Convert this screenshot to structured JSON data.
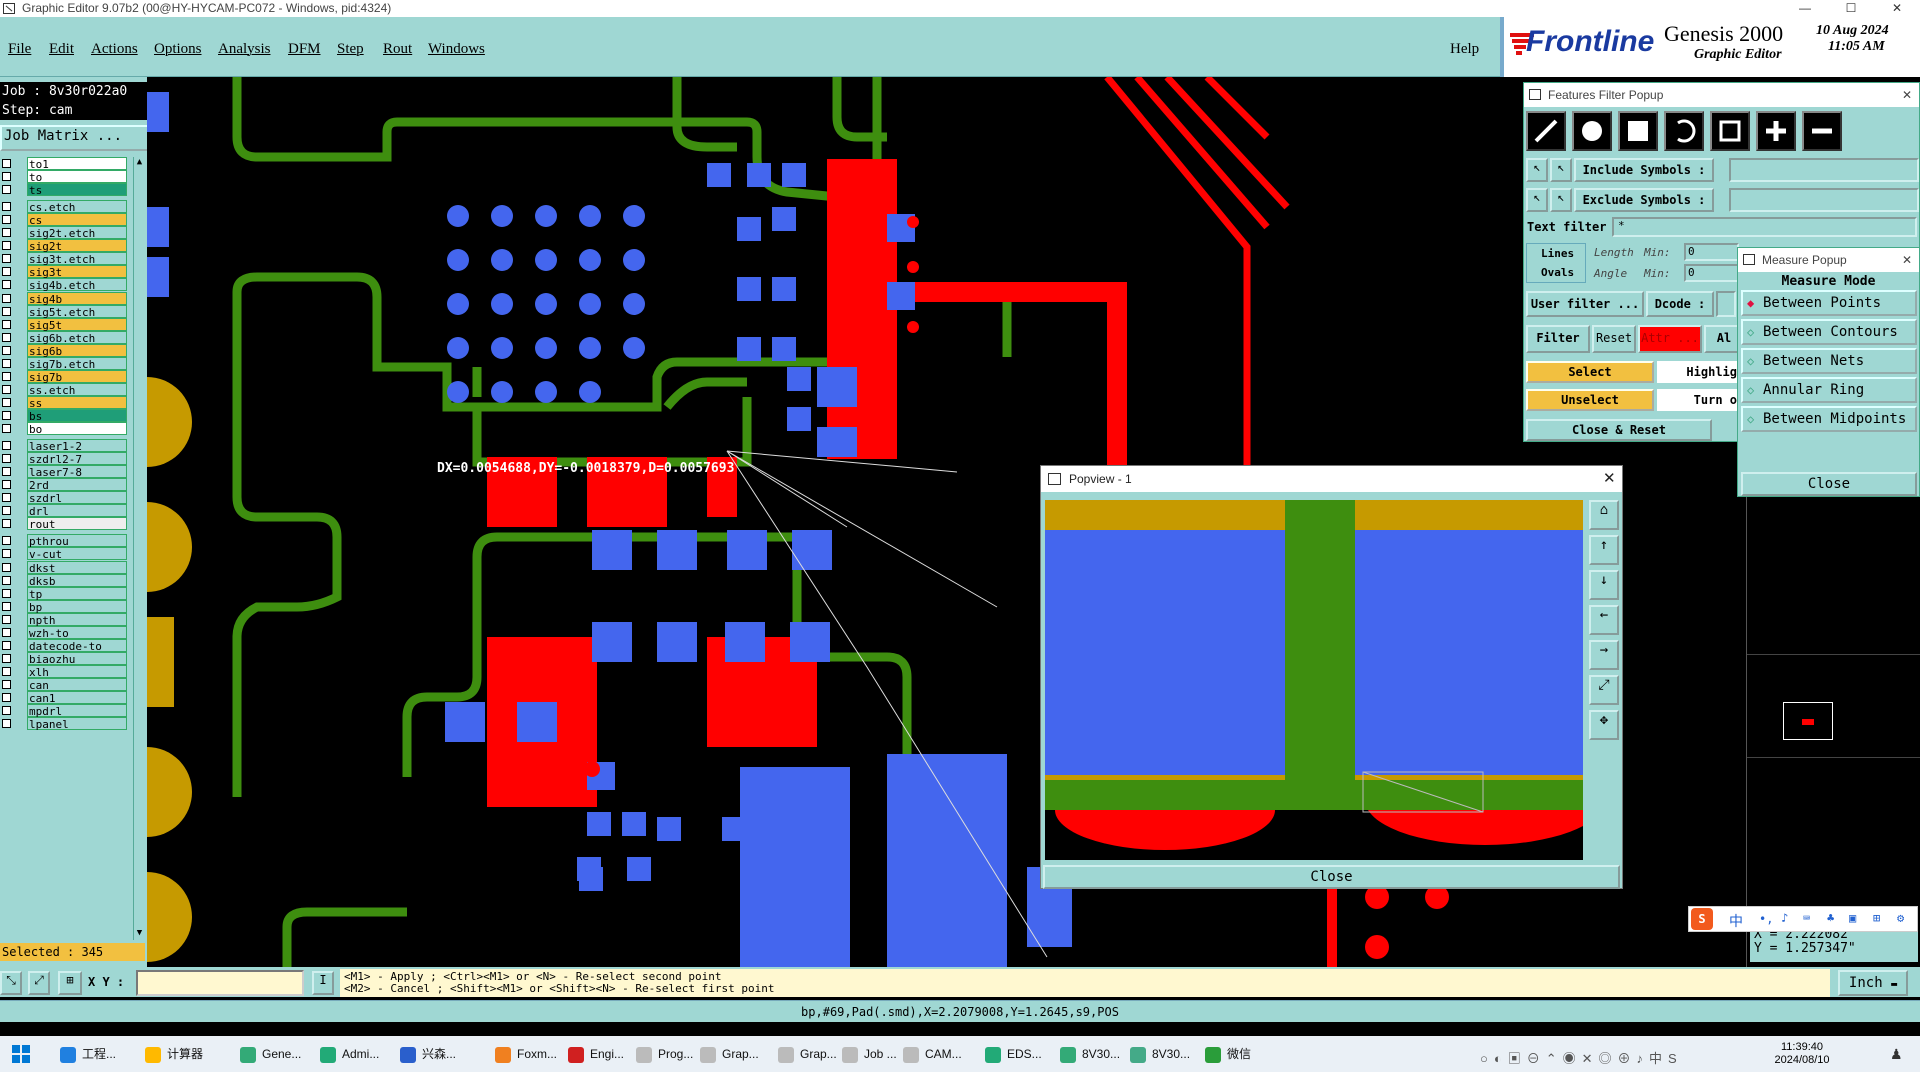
{
  "window": {
    "title": "Graphic Editor 9.07b2 (00@HY-HYCAM-PC072 - Windows, pid:4324)",
    "controls": [
      "—",
      "☐",
      "✕"
    ]
  },
  "menu": {
    "items": [
      "File",
      "Edit",
      "Actions",
      "Options",
      "Analysis",
      "DFM",
      "Step",
      "Rout",
      "Windows"
    ],
    "help": "Help"
  },
  "brand": {
    "logo": "Frontline",
    "product": "Genesis 2000",
    "subtitle": "Graphic Editor",
    "date": "10 Aug 2024",
    "time": "11:05 AM"
  },
  "left_panel": {
    "job": "Job : 8v30r022a0",
    "step": "Step: cam",
    "job_matrix": "Job Matrix ...",
    "layers": [
      "to1",
      "to",
      "ts",
      "cs.etch",
      "cs",
      "sig2t.etch",
      "sig2t",
      "sig3t.etch",
      "sig3t",
      "sig4b.etch",
      "sig4b",
      "sig5t.etch",
      "sig5t",
      "sig6b.etch",
      "sig6b",
      "sig7b.etch",
      "sig7b",
      "ss.etch",
      "ss",
      "bs",
      "bo",
      "laser1-2",
      "szdrl2-7",
      "laser7-8",
      "2rd",
      "szdrl",
      "drl",
      "rout",
      "pthrou",
      "v-cut",
      "dkst",
      "dksb",
      "tp",
      "bp",
      "npth",
      "wzh-to",
      "datecode-to",
      "biaozhu",
      "xlh",
      "can",
      "can1",
      "mpdrl",
      "lpanel"
    ],
    "selected": "Selected : 345"
  },
  "canvas": {
    "measure_readout": "DX=0.0054688,DY=-0.0018379,D=0.0057693"
  },
  "features_filter": {
    "title": "Features Filter Popup",
    "include_symbols": "Include Symbols :",
    "exclude_symbols": "Exclude Symbols :",
    "text_filter": "Text filter",
    "text_filter_value": "*",
    "lines": "Lines",
    "ovals": "Ovals",
    "length": "Length",
    "angle": "Angle",
    "min": "Min:",
    "min_value": "0",
    "user_filter": "User filter ...",
    "dcode": "Dcode :",
    "filter": "Filter",
    "reset": "Reset",
    "attr": "Attr ...",
    "all": "Al",
    "select": "Select",
    "unselect": "Unselect",
    "highlight": "Highlig",
    "turn_on": "Turn o",
    "close_reset": "Close & Reset"
  },
  "measure_popup": {
    "title": "Measure Popup",
    "mode_header": "Measure Mode",
    "options": [
      "Between Points",
      "Between Contours",
      "Between Nets",
      "Annular Ring",
      "Between Midpoints"
    ],
    "close": "Close"
  },
  "popview": {
    "title": "Popview - 1",
    "close": "Close"
  },
  "coords": {
    "x": "X = 2.222082\"",
    "y": "Y = 1.257347\""
  },
  "command": {
    "xy_label": "X Y :",
    "hint1": "<M1> - Apply  ; <Ctrl><M1> or <N> - Re-select second point",
    "hint2": "<M2> - Cancel ; <Shift><M1> or <Shift><N> - Re-select first point",
    "units": "Inch"
  },
  "status_line": "bp,#69,Pad(.smd),X=2.2079008,Y=1.2645,s9,POS",
  "ime": {
    "lang": "中"
  },
  "taskbar": {
    "items": [
      "工程...",
      "计算器",
      "Gene...",
      "Admi...",
      "兴森...",
      "Foxm...",
      "Engi...",
      "Prog...",
      "Grap...",
      "Grap...",
      "Job ...",
      "CAM...",
      "EDS...",
      "8V30...",
      "8V30...",
      "微信"
    ],
    "time": "11:39:40",
    "date": "2024/08/10"
  },
  "colors": {
    "panel": "#9fd7d3",
    "copper_green": "#3e8e0f",
    "pad_blue": "#4466ee",
    "pad_red": "#ff0000",
    "gold": "#c69a00",
    "highlight_yellow": "#f2c040"
  }
}
